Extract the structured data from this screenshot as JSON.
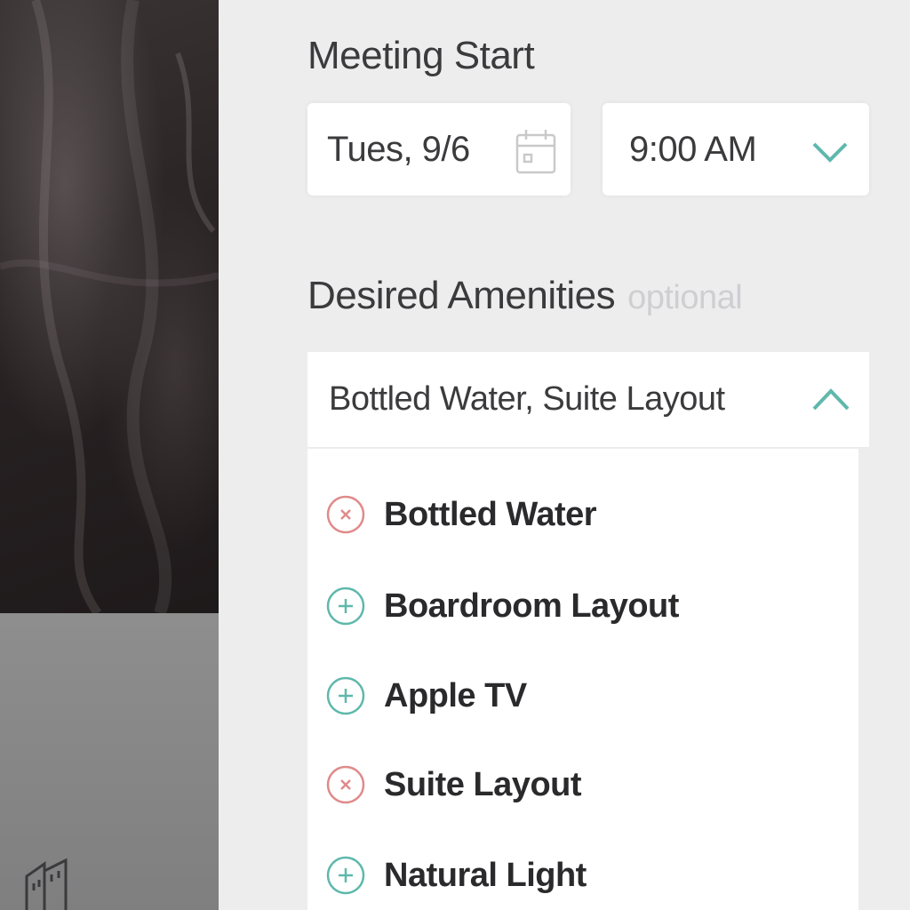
{
  "meeting_start": {
    "label": "Meeting Start",
    "date_value": "Tues, 9/6",
    "time_value": "9:00 AM"
  },
  "amenities": {
    "label": "Desired Amenities",
    "optional_label": "optional",
    "selected_value": "Bottled Water, Suite Layout",
    "options": [
      {
        "label": "Bottled Water",
        "state": "selected",
        "icon": "remove-icon"
      },
      {
        "label": "Boardroom Layout",
        "state": "unselected",
        "icon": "add-icon"
      },
      {
        "label": "Apple TV",
        "state": "unselected",
        "icon": "add-icon"
      },
      {
        "label": "Suite Layout",
        "state": "selected",
        "icon": "remove-icon"
      },
      {
        "label": "Natural Light",
        "state": "unselected",
        "icon": "add-icon"
      }
    ]
  },
  "colors": {
    "accent": "#5fb8ac",
    "remove": "#e08a8a",
    "text": "#3b3a3c",
    "background": "#ededee"
  }
}
